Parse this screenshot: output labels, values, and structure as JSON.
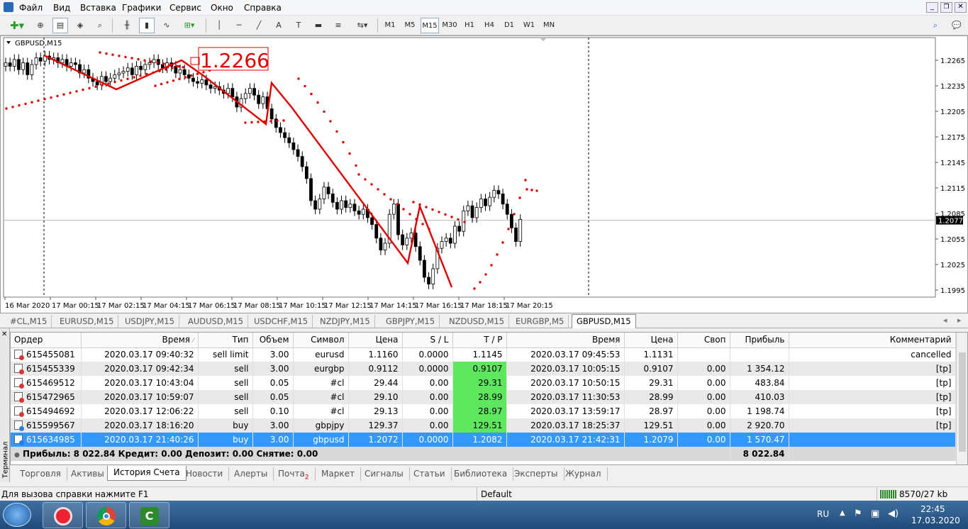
{
  "menu": [
    "Файл",
    "Вид",
    "Вставка",
    "Графики",
    "Сервис",
    "Окно",
    "Справка"
  ],
  "toolbar": {
    "timeframes": [
      "M1",
      "M5",
      "M15",
      "M30",
      "H1",
      "H4",
      "D1",
      "W1",
      "MN"
    ],
    "active_tf": "M15"
  },
  "chart": {
    "symbol_label": "GBPUSD,M15",
    "price_labels": [
      "1.2265",
      "1.2235",
      "1.2205",
      "1.2175",
      "1.2145",
      "1.2115",
      "1.2085",
      "1.2055",
      "1.2025",
      "1.1995"
    ],
    "current_price": "1.2077",
    "big_label": "1.2266",
    "time_labels": [
      "16 Mar 2020",
      "17 Mar 00:15",
      "17 Mar 02:15",
      "17 Mar 04:15",
      "17 Mar 06:15",
      "17 Mar 08:15",
      "17 Mar 10:15",
      "17 Mar 12:15",
      "17 Mar 14:15",
      "17 Mar 16:15",
      "17 Mar 18:15",
      "17 Mar 20:15"
    ],
    "up_color": "#ffffff",
    "down_color": "#000000",
    "zigzag_color": "#dd0000",
    "sar_color": "#dd0000"
  },
  "chart_tabs": [
    "#CL,M15",
    "EURUSD,M15",
    "USDJPY,M15",
    "AUDUSD,M15",
    "USDCHF,M15",
    "NZDJPY,M15",
    "GBPJPY,M15",
    "NZDUSD,M15",
    "EURGBP,M5",
    "GBPUSD,M15"
  ],
  "active_chart_tab": "GBPUSD,M15",
  "terminal": {
    "side_label": "Терминал",
    "columns": [
      "Ордер",
      "Время",
      "Тип",
      "Объем",
      "Символ",
      "Цена",
      "S / L",
      "T / P",
      "Время",
      "Цена",
      "Своп",
      "Прибыль",
      "Комментарий"
    ],
    "rows": [
      {
        "order": "615455081",
        "time": "2020.03.17 09:40:32",
        "type": "sell limit",
        "volume": "3.00",
        "symbol": "eurusd",
        "price": "1.1160",
        "sl": "0.0000",
        "tp": "1.1145",
        "ctime": "2020.03.17 09:45:53",
        "cprice": "1.1131",
        "swap": "",
        "profit": "",
        "comment": "cancelled",
        "tp_hit": false
      },
      {
        "order": "615455339",
        "time": "2020.03.17 09:42:34",
        "type": "sell",
        "volume": "3.00",
        "symbol": "eurgbp",
        "price": "0.9112",
        "sl": "0.0000",
        "tp": "0.9107",
        "ctime": "2020.03.17 10:05:15",
        "cprice": "0.9107",
        "swap": "0.00",
        "profit": "1 354.12",
        "comment": "[tp]",
        "tp_hit": true
      },
      {
        "order": "615469512",
        "time": "2020.03.17 10:43:04",
        "type": "sell",
        "volume": "0.05",
        "symbol": "#cl",
        "price": "29.44",
        "sl": "0.00",
        "tp": "29.31",
        "ctime": "2020.03.17 10:50:15",
        "cprice": "29.31",
        "swap": "0.00",
        "profit": "483.84",
        "comment": "[tp]",
        "tp_hit": true
      },
      {
        "order": "615472965",
        "time": "2020.03.17 10:59:07",
        "type": "sell",
        "volume": "0.05",
        "symbol": "#cl",
        "price": "29.10",
        "sl": "0.00",
        "tp": "28.99",
        "ctime": "2020.03.17 11:30:53",
        "cprice": "28.99",
        "swap": "0.00",
        "profit": "410.03",
        "comment": "[tp]",
        "tp_hit": true
      },
      {
        "order": "615494692",
        "time": "2020.03.17 12:06:22",
        "type": "sell",
        "volume": "0.10",
        "symbol": "#cl",
        "price": "29.13",
        "sl": "0.00",
        "tp": "28.97",
        "ctime": "2020.03.17 13:59:17",
        "cprice": "28.97",
        "swap": "0.00",
        "profit": "1 198.74",
        "comment": "[tp]",
        "tp_hit": true
      },
      {
        "order": "615599567",
        "time": "2020.03.17 18:16:20",
        "type": "buy",
        "volume": "3.00",
        "symbol": "gbpjpy",
        "price": "129.37",
        "sl": "0.00",
        "tp": "129.51",
        "ctime": "2020.03.17 18:25:37",
        "cprice": "129.51",
        "swap": "0.00",
        "profit": "2 920.70",
        "comment": "[tp]",
        "tp_hit": true
      },
      {
        "order": "615634985",
        "time": "2020.03.17 21:40:26",
        "type": "buy",
        "volume": "3.00",
        "symbol": "gbpusd",
        "price": "1.2072",
        "sl": "0.0000",
        "tp": "1.2082",
        "ctime": "2020.03.17 21:42:31",
        "cprice": "1.2079",
        "swap": "0.00",
        "profit": "1 570.47",
        "comment": "",
        "tp_hit": false,
        "selected": true
      }
    ],
    "summary_text": "Прибыль: 8 022.84  Кредит: 0.00  Депозит: 0.00  Снятие: 0.00",
    "summary_total": "8 022.84",
    "tabs": [
      "Торговля",
      "Активы",
      "История Счета",
      "Новости",
      "Алерты",
      "Почта",
      "Маркет",
      "Сигналы",
      "Статьи",
      "Библиотека",
      "Эксперты",
      "Журнал"
    ],
    "active_tab": "История Счета",
    "mail_badge": "2"
  },
  "status": {
    "help": "Для вызова справки нажмите F1",
    "profile": "Default",
    "traffic": "8570/27 kb"
  },
  "taskbar": {
    "lang": "RU",
    "time": "22:45",
    "date": "17.03.2020"
  }
}
